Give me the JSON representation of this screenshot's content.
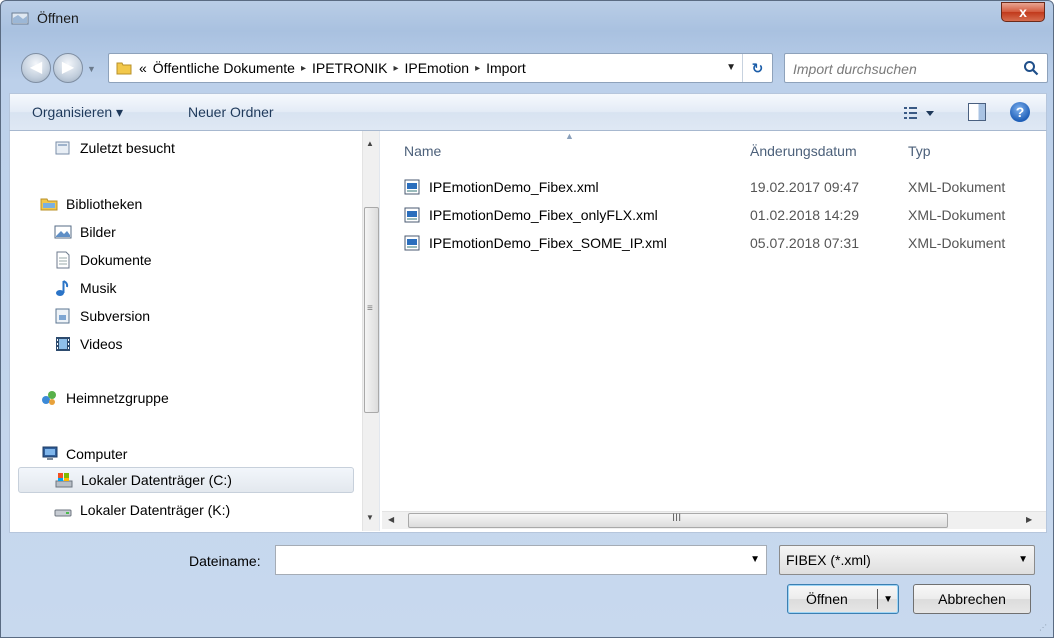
{
  "window": {
    "title": "Öffnen",
    "close_label": "x"
  },
  "address": {
    "lead": "«",
    "crumbs": [
      "Öffentliche Dokumente",
      "IPETRONIK",
      "IPEmotion",
      "Import"
    ],
    "separator": "▸"
  },
  "search": {
    "placeholder": "Import durchsuchen"
  },
  "toolbar": {
    "organize_label": "Organisieren ▾",
    "new_folder_label": "Neuer Ordner",
    "help_label": "?"
  },
  "nav_pane": {
    "items": [
      {
        "label": "Zuletzt besucht",
        "icon": "recent-places-icon"
      },
      {
        "label": "Bibliotheken",
        "icon": "libraries-icon"
      },
      {
        "label": "Bilder",
        "icon": "pictures-icon"
      },
      {
        "label": "Dokumente",
        "icon": "documents-icon"
      },
      {
        "label": "Musik",
        "icon": "music-icon"
      },
      {
        "label": "Subversion",
        "icon": "subversion-icon"
      },
      {
        "label": "Videos",
        "icon": "videos-icon"
      },
      {
        "label": "Heimnetzgruppe",
        "icon": "homegroup-icon"
      },
      {
        "label": "Computer",
        "icon": "computer-icon"
      },
      {
        "label": "Lokaler Datenträger (C:)",
        "icon": "drive-c-icon",
        "selected": true
      },
      {
        "label": "Lokaler Datenträger (K:)",
        "icon": "drive-icon"
      }
    ]
  },
  "file_list": {
    "columns": [
      "Name",
      "Änderungsdatum",
      "Typ"
    ],
    "rows": [
      {
        "name": "IPEmotionDemo_Fibex.xml",
        "date": "19.02.2017 09:47",
        "type": "XML-Dokument"
      },
      {
        "name": "IPEmotionDemo_Fibex_onlyFLX.xml",
        "date": "01.02.2018 14:29",
        "type": "XML-Dokument"
      },
      {
        "name": "IPEmotionDemo_Fibex_SOME_IP.xml",
        "date": "05.07.2018 07:31",
        "type": "XML-Dokument"
      }
    ]
  },
  "bottom": {
    "filename_label": "Dateiname:",
    "filename_value": "",
    "filter_value": "FIBEX (*.xml)",
    "open_label": "Öffnen",
    "cancel_label": "Abbrechen"
  },
  "colors": {
    "accent": "#1e395b",
    "selection": "#e3e8ee"
  }
}
